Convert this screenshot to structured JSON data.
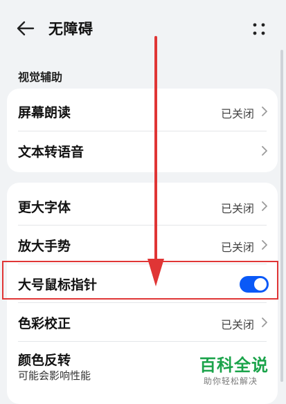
{
  "header": {
    "title": "无障碍"
  },
  "section": {
    "title": "视觉辅助"
  },
  "card1": {
    "screen_reader": {
      "label": "屏幕朗读",
      "status": "已关闭"
    },
    "tts": {
      "label": "文本转语音"
    }
  },
  "card2": {
    "large_font": {
      "label": "更大字体",
      "status": "已关闭"
    },
    "magnify": {
      "label": "放大手势",
      "status": "已关闭"
    },
    "large_pointer": {
      "label": "大号鼠标指针",
      "enabled": true
    },
    "color_correction": {
      "label": "色彩校正",
      "status": "已关闭"
    },
    "color_inversion": {
      "label": "颜色反转",
      "sublabel": "可能会影响性能"
    }
  },
  "watermark": {
    "main": "百科全说",
    "sub": "助你轻松解决"
  },
  "colors": {
    "accent": "#0a59f7",
    "highlight": "#e03535",
    "arrow": "#e03535",
    "watermark": "#1aa34a"
  },
  "icons": {
    "back": "arrow-left-icon",
    "more": "more-dots-icon",
    "chevron": "chevron-right-icon"
  }
}
